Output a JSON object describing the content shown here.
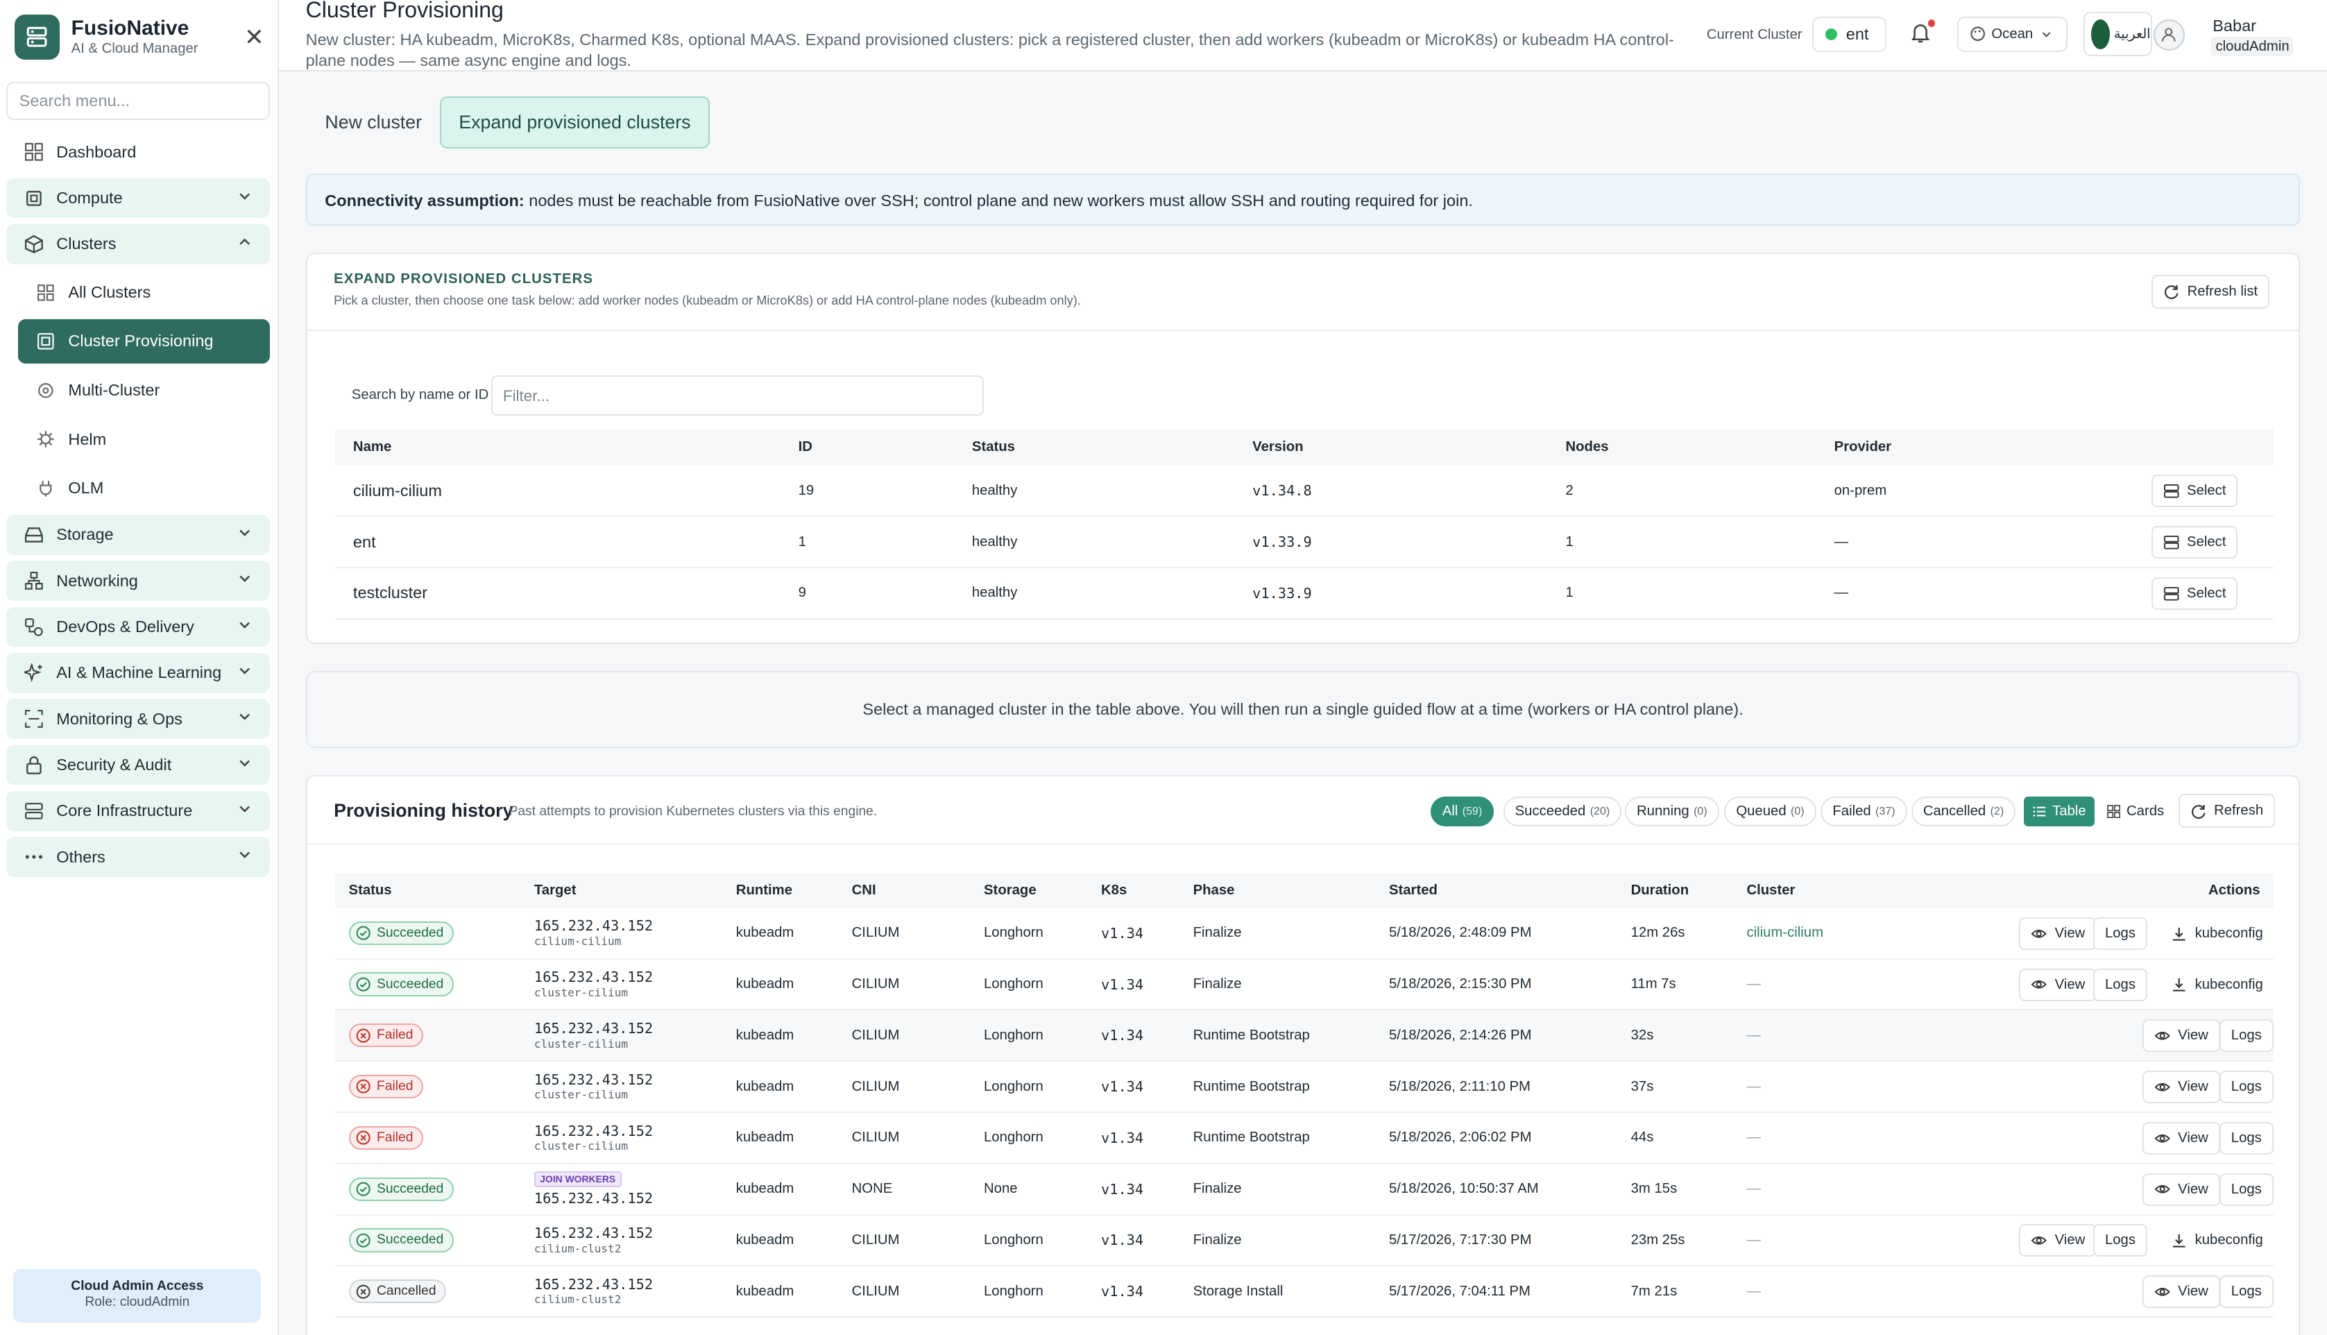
{
  "brand": {
    "title": "FusioNative",
    "subtitle": "AI & Cloud Manager"
  },
  "sidebar": {
    "search_placeholder": "Search menu...",
    "dashboard": "Dashboard",
    "groups": {
      "compute": "Compute",
      "clusters": "Clusters",
      "storage": "Storage",
      "networking": "Networking",
      "devops": "DevOps & Delivery",
      "ai": "AI & Machine Learning",
      "monitoring": "Monitoring & Ops",
      "security": "Security & Audit",
      "core": "Core Infrastructure",
      "others": "Others"
    },
    "cluster_items": {
      "all": "All Clusters",
      "provisioning": "Cluster Provisioning",
      "multi": "Multi-Cluster",
      "helm": "Helm",
      "olm": "OLM"
    },
    "admin": {
      "title": "Cloud Admin Access",
      "role": "Role: cloudAdmin"
    }
  },
  "header": {
    "title": "Cluster Provisioning",
    "description": "New cluster: HA kubeadm, MicroK8s, Charmed K8s, optional MAAS. Expand provisioned clusters: pick a registered cluster, then add workers (kubeadm or MicroK8s) or kubeadm HA control-plane nodes — same async engine and logs.",
    "current_cluster_label": "Current Cluster",
    "current_cluster": "ent",
    "theme": "Ocean",
    "lang": "العربية",
    "user_name": "Babar",
    "user_role": "cloudAdmin"
  },
  "tabs": {
    "new": "New cluster",
    "expand": "Expand provisioned clusters"
  },
  "banner": {
    "bold": "Connectivity assumption:",
    "text": " nodes must be reachable from FusioNative over SSH; control plane and new workers must allow SSH and routing required for join."
  },
  "expand": {
    "title": "EXPAND PROVISIONED CLUSTERS",
    "subtitle": "Pick a cluster, then choose one task below: add worker nodes (kubeadm or MicroK8s) or add HA control-plane nodes (kubeadm only).",
    "refresh": "Refresh list",
    "filter_label": "Search by name or ID",
    "filter_placeholder": "Filter...",
    "columns": {
      "name": "Name",
      "id": "ID",
      "status": "Status",
      "version": "Version",
      "nodes": "Nodes",
      "provider": "Provider"
    },
    "rows": [
      {
        "name": "cilium-cilium",
        "id": "19",
        "status": "healthy",
        "version": "v1.34.8",
        "nodes": "2",
        "provider": "on-prem",
        "action": "Select"
      },
      {
        "name": "ent",
        "id": "1",
        "status": "healthy",
        "version": "v1.33.9",
        "nodes": "1",
        "provider": "—",
        "action": "Select"
      },
      {
        "name": "testcluster",
        "id": "9",
        "status": "healthy",
        "version": "v1.33.9",
        "nodes": "1",
        "provider": "—",
        "action": "Select"
      }
    ]
  },
  "hint": "Select a managed cluster in the table above. You will then run a single guided flow at a time (workers or HA control plane).",
  "history": {
    "title": "Provisioning history",
    "subtitle": "Past attempts to provision Kubernetes clusters via this engine.",
    "filters": [
      {
        "label": "All",
        "count": "(59)"
      },
      {
        "label": "Succeeded",
        "count": "(20)"
      },
      {
        "label": "Running",
        "count": "(0)"
      },
      {
        "label": "Queued",
        "count": "(0)"
      },
      {
        "label": "Failed",
        "count": "(37)"
      },
      {
        "label": "Cancelled",
        "count": "(2)"
      }
    ],
    "view_table": "Table",
    "view_cards": "Cards",
    "refresh": "Refresh",
    "columns": {
      "status": "Status",
      "target": "Target",
      "runtime": "Runtime",
      "cni": "CNI",
      "storage": "Storage",
      "k8s": "K8s",
      "phase": "Phase",
      "started": "Started",
      "duration": "Duration",
      "cluster": "Cluster",
      "actions": "Actions"
    },
    "action_labels": {
      "view": "View",
      "logs": "Logs",
      "kubeconfig": "kubeconfig"
    },
    "rows": [
      {
        "status": "Succeeded",
        "ip": "165.232.43.152",
        "name": "cilium-cilium",
        "tag": "",
        "runtime": "kubeadm",
        "cni": "CILIUM",
        "storage": "Longhorn",
        "k8s": "v1.34",
        "phase": "Finalize",
        "started": "5/18/2026, 2:48:09 PM",
        "duration": "12m 26s",
        "cluster": "cilium-cilium"
      },
      {
        "status": "Succeeded",
        "ip": "165.232.43.152",
        "name": "cluster-cilium",
        "tag": "",
        "runtime": "kubeadm",
        "cni": "CILIUM",
        "storage": "Longhorn",
        "k8s": "v1.34",
        "phase": "Finalize",
        "started": "5/18/2026, 2:15:30 PM",
        "duration": "11m 7s",
        "cluster": "—"
      },
      {
        "status": "Failed",
        "ip": "165.232.43.152",
        "name": "cluster-cilium",
        "tag": "",
        "runtime": "kubeadm",
        "cni": "CILIUM",
        "storage": "Longhorn",
        "k8s": "v1.34",
        "phase": "Runtime Bootstrap",
        "started": "5/18/2026, 2:14:26 PM",
        "duration": "32s",
        "cluster": "—"
      },
      {
        "status": "Failed",
        "ip": "165.232.43.152",
        "name": "cluster-cilium",
        "tag": "",
        "runtime": "kubeadm",
        "cni": "CILIUM",
        "storage": "Longhorn",
        "k8s": "v1.34",
        "phase": "Runtime Bootstrap",
        "started": "5/18/2026, 2:11:10 PM",
        "duration": "37s",
        "cluster": "—"
      },
      {
        "status": "Failed",
        "ip": "165.232.43.152",
        "name": "cluster-cilium",
        "tag": "",
        "runtime": "kubeadm",
        "cni": "CILIUM",
        "storage": "Longhorn",
        "k8s": "v1.34",
        "phase": "Runtime Bootstrap",
        "started": "5/18/2026, 2:06:02 PM",
        "duration": "44s",
        "cluster": "—"
      },
      {
        "status": "Succeeded",
        "ip": "165.232.43.152",
        "name": "",
        "tag": "JOIN WORKERS",
        "runtime": "kubeadm",
        "cni": "NONE",
        "storage": "None",
        "k8s": "v1.34",
        "phase": "Finalize",
        "started": "5/18/2026, 10:50:37 AM",
        "duration": "3m 15s",
        "cluster": "—"
      },
      {
        "status": "Succeeded",
        "ip": "165.232.43.152",
        "name": "cilium-clust2",
        "tag": "",
        "runtime": "kubeadm",
        "cni": "CILIUM",
        "storage": "Longhorn",
        "k8s": "v1.34",
        "phase": "Finalize",
        "started": "5/17/2026, 7:17:30 PM",
        "duration": "23m 25s",
        "cluster": "—"
      },
      {
        "status": "Cancelled",
        "ip": "165.232.43.152",
        "name": "cilium-clust2",
        "tag": "",
        "runtime": "kubeadm",
        "cni": "CILIUM",
        "storage": "Longhorn",
        "k8s": "v1.34",
        "phase": "Storage Install",
        "started": "5/17/2026, 7:04:11 PM",
        "duration": "7m 21s",
        "cluster": "—"
      }
    ]
  },
  "colors": {
    "accent": "#2f6b5f",
    "accent_light": "#e8f6f2",
    "success": "#1f6b3f",
    "danger": "#b2302b"
  }
}
